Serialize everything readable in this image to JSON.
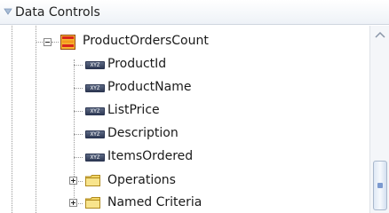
{
  "panel": {
    "title": "Data Controls"
  },
  "tree": {
    "collection": {
      "label": "ProductOrdersCount",
      "icon": "data-collection-icon"
    },
    "attributes": [
      {
        "label": "ProductId",
        "badge": "XYZ"
      },
      {
        "label": "ProductName",
        "badge": "XYZ"
      },
      {
        "label": "ListPrice",
        "badge": "XYZ"
      },
      {
        "label": "Description",
        "badge": "XYZ"
      },
      {
        "label": "ItemsOrdered",
        "badge": "XYZ"
      }
    ],
    "folders": [
      {
        "label": "Operations",
        "icon": "folder-icon"
      },
      {
        "label": "Named Criteria",
        "icon": "folder-icon"
      }
    ]
  },
  "colors": {
    "folder": "#f2d565",
    "collection_red": "#d9261c",
    "collection_orange": "#f39a1e",
    "thumb_grip": "#7c9ad0"
  }
}
